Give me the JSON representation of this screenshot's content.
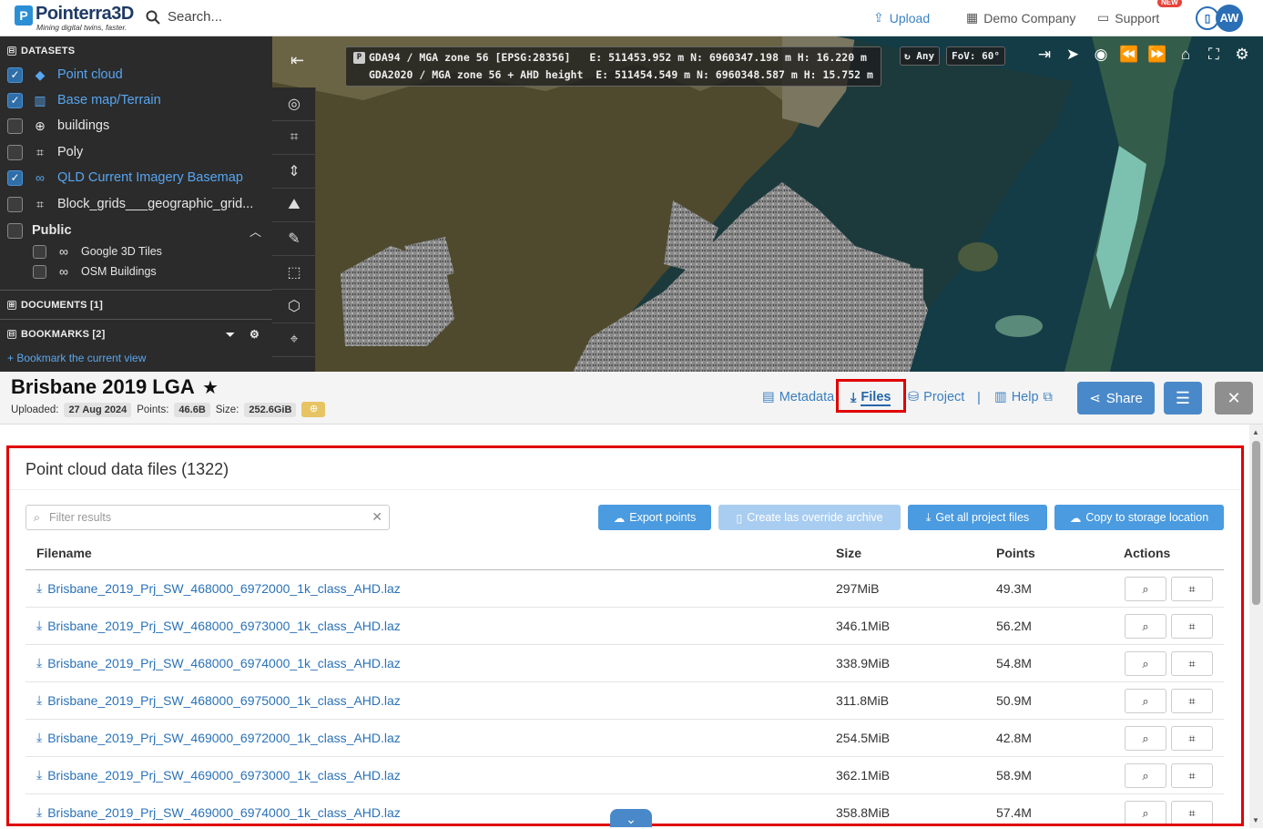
{
  "topbar": {
    "logo_name": "Pointerra3D",
    "logo_tagline": "Mining digital twins, faster.",
    "search_placeholder": "Search...",
    "upload_label": "Upload",
    "company_label": "Demo Company",
    "support_label": "Support",
    "new_badge": "NEW",
    "avatar_initials": "AW"
  },
  "sidebar": {
    "datasets_heading": "DATASETS",
    "datasets": [
      {
        "label": "Point cloud",
        "checked": true,
        "icon": "pointcloud-icon"
      },
      {
        "label": "Base map/Terrain",
        "checked": true,
        "icon": "map-icon"
      },
      {
        "label": "buildings",
        "checked": false,
        "icon": "globe-icon"
      },
      {
        "label": "Poly",
        "checked": false,
        "icon": "polygon-icon"
      },
      {
        "label": "QLD Current Imagery Basemap",
        "checked": true,
        "icon": "link-icon"
      },
      {
        "label": "Block_grids___geographic_grid...",
        "checked": false,
        "icon": "polygon-icon"
      }
    ],
    "public_label": "Public",
    "public_items": [
      {
        "label": "Google 3D Tiles",
        "checked": false
      },
      {
        "label": "OSM Buildings",
        "checked": false
      }
    ],
    "documents_heading": "DOCUMENTS [1]",
    "bookmarks_heading": "BOOKMARKS [2]",
    "bookmark_link": "+ Bookmark the current view"
  },
  "map": {
    "coords_line1": "GDA94 / MGA zone 56 [EPSG:28356]   E: 511453.952 m N: 6960347.198 m H: 16.220 m",
    "coords_line2": "GDA2020 / MGA zone 56 + AHD height  E: 511454.549 m N: 6960348.587 m H: 15.752 m",
    "any_label": "Any",
    "fov_label": "FoV: 60°"
  },
  "project": {
    "title": "Brisbane 2019 LGA",
    "uploaded_label": "Uploaded:",
    "uploaded_value": "27 Aug 2024",
    "points_label": "Points:",
    "points_value": "46.6B",
    "size_label": "Size:",
    "size_value": "252.6GiB",
    "tabs": {
      "metadata": "Metadata",
      "files": "Files",
      "project": "Project",
      "separator": "|",
      "help": "Help"
    },
    "share_label": "Share"
  },
  "files": {
    "title": "Point cloud data files (1322)",
    "filter_placeholder": "Filter results",
    "buttons": {
      "export": "Export points",
      "override": "Create las override archive",
      "get_all": "Get all project files",
      "copy": "Copy to storage location"
    },
    "columns": [
      "Filename",
      "Size",
      "Points",
      "Actions"
    ],
    "rows": [
      {
        "filename": "Brisbane_2019_Prj_SW_468000_6972000_1k_class_AHD.laz",
        "size": "297MiB",
        "points": "49.3M"
      },
      {
        "filename": "Brisbane_2019_Prj_SW_468000_6973000_1k_class_AHD.laz",
        "size": "346.1MiB",
        "points": "56.2M"
      },
      {
        "filename": "Brisbane_2019_Prj_SW_468000_6974000_1k_class_AHD.laz",
        "size": "338.9MiB",
        "points": "54.8M"
      },
      {
        "filename": "Brisbane_2019_Prj_SW_468000_6975000_1k_class_AHD.laz",
        "size": "311.8MiB",
        "points": "50.9M"
      },
      {
        "filename": "Brisbane_2019_Prj_SW_469000_6972000_1k_class_AHD.laz",
        "size": "254.5MiB",
        "points": "42.8M"
      },
      {
        "filename": "Brisbane_2019_Prj_SW_469000_6973000_1k_class_AHD.laz",
        "size": "362.1MiB",
        "points": "58.9M"
      },
      {
        "filename": "Brisbane_2019_Prj_SW_469000_6974000_1k_class_AHD.laz",
        "size": "358.8MiB",
        "points": "57.4M"
      }
    ]
  },
  "colors": {
    "accent": "#4a89c9",
    "link": "#2a72b8",
    "highlight": "#e00000",
    "sidebar_bg": "#2b2b2b"
  }
}
